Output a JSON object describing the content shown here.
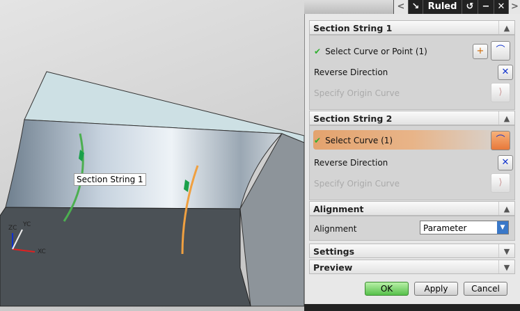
{
  "viewport": {
    "annotation": "Section String 1",
    "triad": {
      "zc": "ZC",
      "yc": "YC",
      "xc": "XC"
    }
  },
  "titlebar": {
    "title": "Ruled"
  },
  "section1": {
    "title": "Section String 1",
    "select_label": "Select Curve or Point (1)",
    "reverse_label": "Reverse Direction",
    "origin_label": "Specify Origin Curve"
  },
  "section2": {
    "title": "Section String 2",
    "select_label": "Select Curve (1)",
    "reverse_label": "Reverse Direction",
    "origin_label": "Specify Origin Curve"
  },
  "alignment": {
    "title": "Alignment",
    "label": "Alignment",
    "value": "Parameter"
  },
  "settings": {
    "title": "Settings"
  },
  "preview": {
    "title": "Preview"
  },
  "buttons": {
    "ok": "OK",
    "apply": "Apply",
    "cancel": "Cancel"
  },
  "colors": {
    "highlight": "#e3a36e",
    "ok": "#56c04a",
    "curve1": "#4caf50",
    "curve2": "#f0a040"
  }
}
